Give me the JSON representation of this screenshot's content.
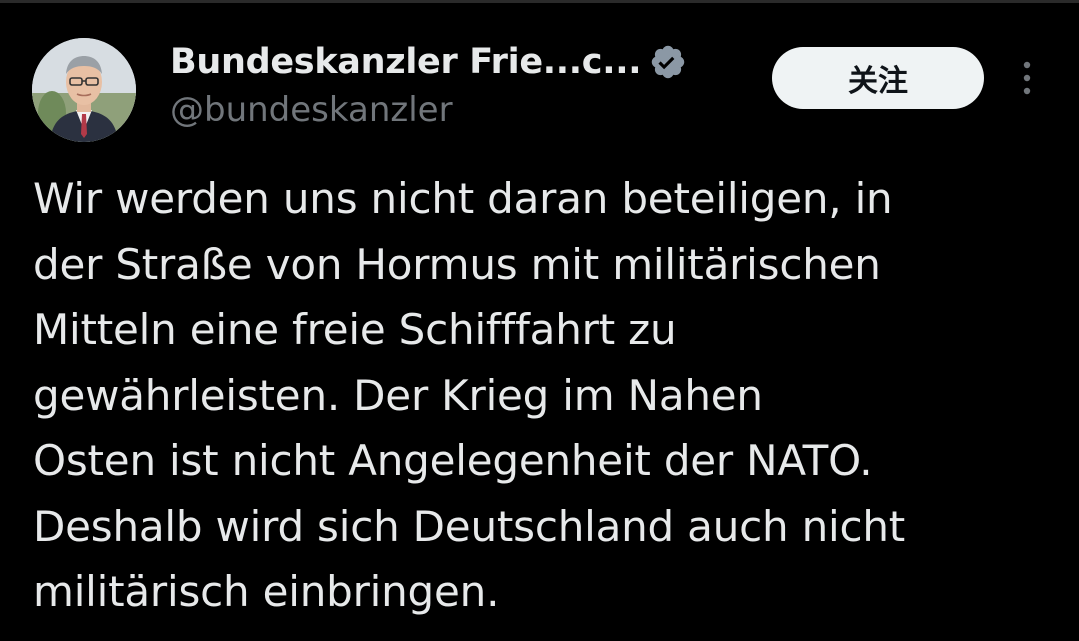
{
  "author": {
    "display_name": "Bundeskanzler Frie...c...",
    "handle": "@bundeskanzler",
    "verified": true
  },
  "follow_button": {
    "label": "关注"
  },
  "more_menu": {
    "icon": "more-vertical-icon"
  },
  "tweet": {
    "lines": [
      "Wir werden uns nicht daran beteiligen, in",
      "der Straße von Hormus mit militärischen",
      "Mitteln eine freie Schifffahrt zu",
      "gewährleisten. Der Krieg im Nahen",
      "Osten ist nicht Angelegenheit der NATO.",
      "Deshalb wird sich Deutschland auch nicht",
      "militärisch einbringen."
    ]
  },
  "colors": {
    "background": "#000000",
    "primary_text": "#e7e9ea",
    "secondary_text": "#71767b",
    "verified_badge": "#1d9bf0",
    "follow_button_bg": "#eff3f4"
  }
}
